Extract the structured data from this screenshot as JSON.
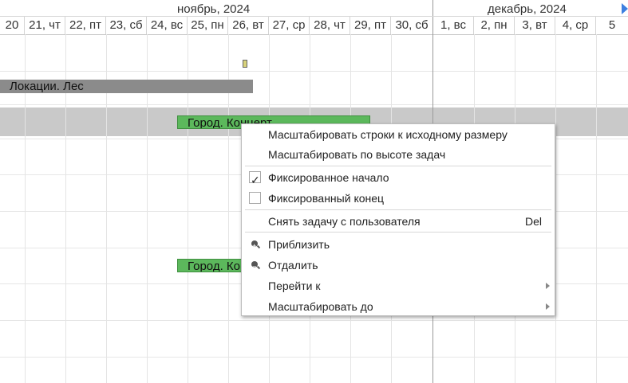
{
  "header": {
    "months": [
      "ноябрь, 2024",
      "декабрь, 2024"
    ],
    "days": [
      "20",
      "21, чт",
      "22, пт",
      "23, сб",
      "24, вс",
      "25, пн",
      "26, вт",
      "27, ср",
      "28, чт",
      "29, пт",
      "30, сб",
      "1, вс",
      "2, пн",
      "3, вт",
      "4, ср",
      "5"
    ]
  },
  "tasks": [
    {
      "label": "Локации. Лес",
      "color": "#8b8b8b"
    },
    {
      "label": "Город. Концерт",
      "color": "#5cb85c"
    },
    {
      "label": "Город. Концерт",
      "color": "#5cb85c"
    }
  ],
  "context_menu": {
    "items": [
      {
        "label": "Масштабировать строки к исходному размеру"
      },
      {
        "label": "Масштабировать по высоте задач"
      },
      {
        "label": "Фиксированное начало",
        "checked": true
      },
      {
        "label": "Фиксированный конец",
        "checked": false
      },
      {
        "label": "Снять задачу с пользователя",
        "shortcut": "Del"
      },
      {
        "label": "Приблизить",
        "icon": "zoom-in-icon"
      },
      {
        "label": "Отдалить",
        "icon": "zoom-out-icon"
      },
      {
        "label": "Перейти к",
        "submenu": true
      },
      {
        "label": "Масштабировать до",
        "submenu": true
      }
    ]
  },
  "colors": {
    "accent": "#3d7fe0",
    "task_green": "#5cb85c",
    "task_gray": "#8b8b8b",
    "row_highlight": "#c9c9c9"
  }
}
